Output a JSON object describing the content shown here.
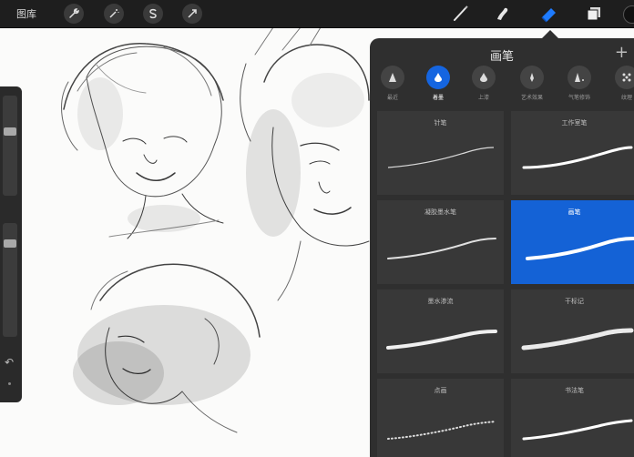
{
  "topbar": {
    "gallery_label": "图库",
    "left_tools": [
      "wrench-icon",
      "magic-wand-icon",
      "selection-s-icon",
      "transform-arrow-icon"
    ],
    "right_tools": [
      "brush-icon",
      "smudge-icon",
      "eraser-icon",
      "layers-icon"
    ],
    "active_right_tool": "eraser-icon",
    "accent_color": "#1e7bff"
  },
  "panel": {
    "title": "画笔",
    "plus": "+",
    "categories": [
      {
        "label": "最近",
        "icon": "pencil-tip-icon",
        "active": false
      },
      {
        "label": "着墨",
        "icon": "ink-drop-icon",
        "active": true
      },
      {
        "label": "上漆",
        "icon": "paint-drop-icon",
        "active": false
      },
      {
        "label": "艺术效果",
        "icon": "art-brush-icon",
        "active": false
      },
      {
        "label": "气笔修饰",
        "icon": "airbrush-icon",
        "active": false
      },
      {
        "label": "纹理",
        "icon": "texture-icon",
        "active": false
      }
    ],
    "brushes": [
      {
        "name": "针笔",
        "selected": false
      },
      {
        "name": "工作室笔",
        "selected": false
      },
      {
        "name": "凝胶墨水笔",
        "selected": false
      },
      {
        "name": "画笔",
        "selected": true
      },
      {
        "name": "墨水渗流",
        "selected": false
      },
      {
        "name": "干标记",
        "selected": false
      },
      {
        "name": "点画",
        "selected": false
      },
      {
        "name": "书法笔",
        "selected": false
      }
    ],
    "selected_color": "#1462d6"
  },
  "sidebar": {
    "sliders": [
      {
        "name": "brush-size",
        "level": 0.25
      },
      {
        "name": "opacity",
        "level": 0.15
      }
    ],
    "undo_icon": "undo-icon",
    "redo_icon": "redo-icon"
  }
}
